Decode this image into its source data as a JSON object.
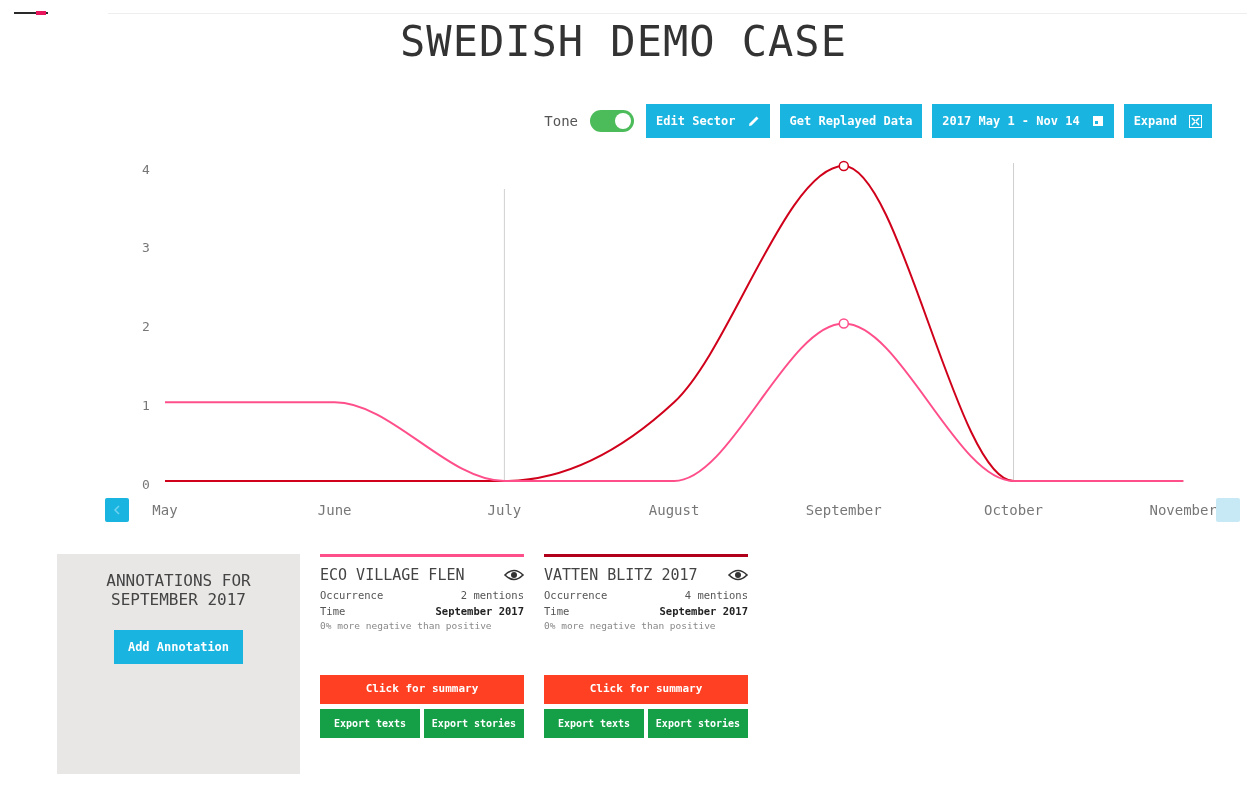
{
  "header": {
    "title": "SWEDISH DEMO CASE"
  },
  "toolbar": {
    "toggle": {
      "label": "Tone",
      "on": true
    },
    "buttons": [
      {
        "label": "Edit Sector",
        "kind": "edit"
      },
      {
        "label": "Get Replayed Data",
        "kind": "plain"
      },
      {
        "label": "2017 May 1 - Nov 14",
        "kind": "date"
      },
      {
        "label": "Expand",
        "kind": "expand"
      }
    ]
  },
  "chart_data": {
    "type": "line",
    "categories": [
      "May",
      "June",
      "July",
      "August",
      "September",
      "October",
      "November"
    ],
    "ylim": [
      0,
      4
    ],
    "yticks": [
      0,
      1,
      2,
      3,
      4
    ],
    "series": [
      {
        "color": "#d0021b",
        "values": [
          0,
          0,
          0,
          1,
          4,
          0,
          0
        ]
      },
      {
        "color": "#ff4f8b",
        "values": [
          1,
          1,
          0,
          0,
          2,
          0,
          0
        ]
      }
    ]
  },
  "annotations": {
    "title": "ANNOTATIONS FOR SEPTEMBER 2017",
    "button": "Add Annotation"
  },
  "cards": [
    {
      "title": "ECO VILLAGE FLEN",
      "color": "#ff4f8b",
      "rows": [
        {
          "label": "Occurrence",
          "value": "2 mentions"
        },
        {
          "label": "Time",
          "value": "September 2017"
        }
      ],
      "note": "0% more negative than positive",
      "summary_button": "Click for summary",
      "export_buttons": [
        "Export texts",
        "Export stories"
      ]
    },
    {
      "title": "VATTEN BLITZ 2017",
      "color": "#b0001a",
      "rows": [
        {
          "label": "Occurrence",
          "value": "4 mentions"
        },
        {
          "label": "Time",
          "value": "September 2017"
        }
      ],
      "note": "0% more negative than positive",
      "summary_button": "Click for summary",
      "export_buttons": [
        "Export texts",
        "Export stories"
      ]
    }
  ]
}
